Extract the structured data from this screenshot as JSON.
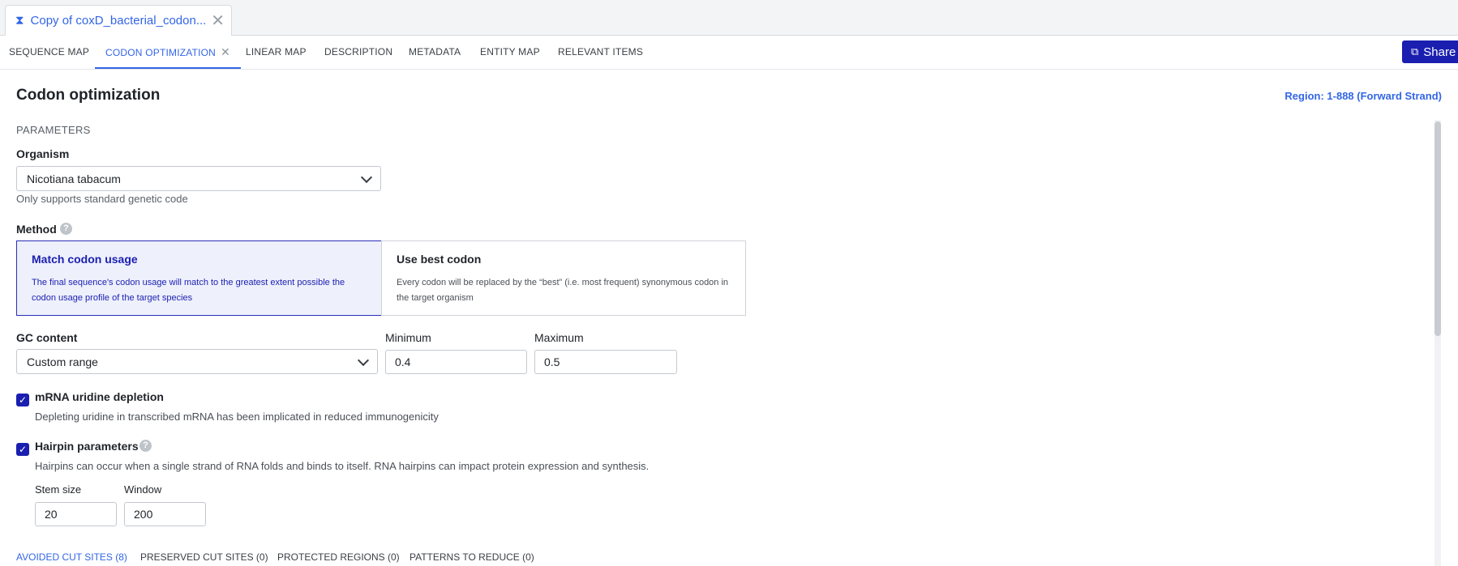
{
  "doc_tab": {
    "title": "Copy of coxD_bacterial_codon...",
    "close": "✕"
  },
  "nav": {
    "tabs": [
      {
        "label": "SEQUENCE MAP"
      },
      {
        "label": "CODON OPTIMIZATION",
        "active": true
      },
      {
        "label": "LINEAR MAP"
      },
      {
        "label": "DESCRIPTION"
      },
      {
        "label": "METADATA"
      },
      {
        "label": "ENTITY MAP"
      },
      {
        "label": "RELEVANT ITEMS"
      }
    ],
    "active_close": "✕",
    "share_label": "Share"
  },
  "page": {
    "title": "Codon optimization",
    "region": "Region: 1-888 (Forward Strand)",
    "parameters_label": "PARAMETERS"
  },
  "organism": {
    "label": "Organism",
    "value": "Nicotiana tabacum",
    "help": "Only supports standard genetic code"
  },
  "method": {
    "label": "Method",
    "options": [
      {
        "title": "Match codon usage",
        "description": "The final sequence's codon usage will match to the greatest extent possible the codon usage profile of the target species",
        "selected": true
      },
      {
        "title": "Use best codon",
        "description": "Every codon will be replaced by the “best” (i.e. most frequent) synonymous codon in the target organism",
        "selected": false
      }
    ]
  },
  "gc_content": {
    "label": "GC content",
    "value": "Custom range",
    "min_label": "Minimum",
    "min_value": "0.4",
    "max_label": "Maximum",
    "max_value": "0.5"
  },
  "mrna": {
    "checked": true,
    "title": "mRNA uridine depletion",
    "description": "Depleting uridine in transcribed mRNA has been implicated in reduced immunogenicity"
  },
  "hairpin": {
    "checked": true,
    "title": "Hairpin parameters",
    "description": "Hairpins can occur when a single strand of RNA folds and binds to itself. RNA hairpins can impact protein expression and synthesis.",
    "stem_label": "Stem size",
    "stem_value": "20",
    "window_label": "Window",
    "window_value": "200"
  },
  "subtabs": [
    {
      "label": "AVOIDED CUT SITES (8)",
      "active": true
    },
    {
      "label": "PRESERVED CUT SITES (0)"
    },
    {
      "label": "PROTECTED REGIONS (0)"
    },
    {
      "label": "PATTERNS TO REDUCE (0)"
    }
  ],
  "icons": {
    "checkmark": "✓",
    "question": "?"
  },
  "colors": {
    "accent": "#3366e6",
    "primary": "#1a1fb0",
    "selected_bg": "#eef0fc"
  }
}
